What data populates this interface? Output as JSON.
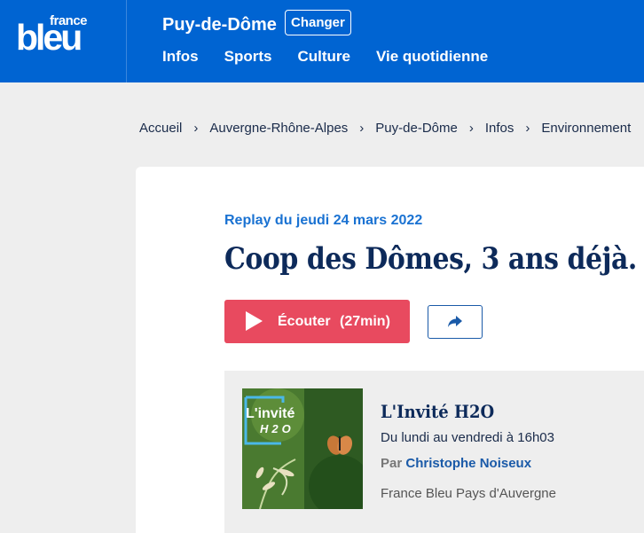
{
  "header": {
    "logo_small": "france",
    "logo_big": "bleu",
    "region": "Puy-de-Dôme",
    "change_label": "Changer",
    "nav": [
      "Infos",
      "Sports",
      "Culture",
      "Vie quotidienne"
    ],
    "background_color": "#0064d2"
  },
  "breadcrumb": [
    "Accueil",
    "Auvergne-Rhône-Alpes",
    "Puy-de-Dôme",
    "Infos",
    "Environnement"
  ],
  "episode": {
    "replay_date": "Replay du jeudi 24 mars 2022",
    "title": "Coop des Dômes, 3 ans déjà.",
    "listen_label": "Écouter",
    "duration": "(27min)",
    "listen_color": "#e84a5f"
  },
  "show": {
    "image_line1": "L'invité",
    "image_line2": "H2O",
    "title": "L'Invité H2O",
    "schedule": "Du lundi au vendredi à 16h03",
    "by_prefix": "Par",
    "author": "Christophe Noiseux",
    "station": "France Bleu Pays d'Auvergne"
  },
  "icons": {
    "play": "play-icon",
    "share": "share-icon",
    "breadcrumb_sep": "chevron-right-icon"
  }
}
